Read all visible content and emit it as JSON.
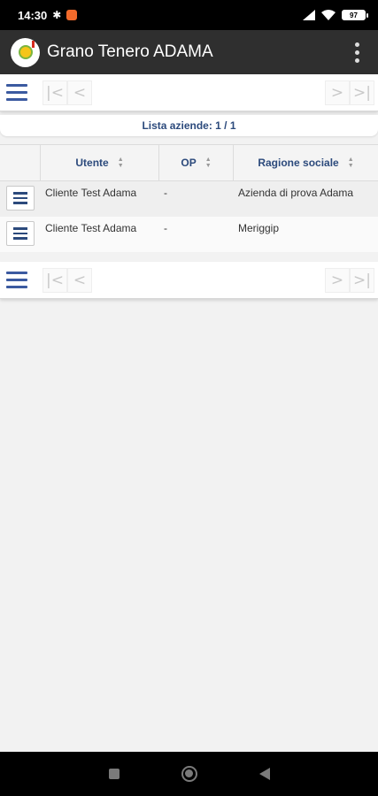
{
  "status_bar": {
    "time": "14:30",
    "battery": "97"
  },
  "app_bar": {
    "title": "Grano Tenero ADAMA"
  },
  "pager": {
    "first": "|<",
    "prev": "<",
    "next": ">",
    "last": ">|"
  },
  "list_label": "Lista aziende: 1 / 1",
  "table": {
    "headers": [
      "Utente",
      "OP",
      "Ragione sociale"
    ],
    "rows": [
      {
        "utente": "Cliente Test Adama",
        "op": "-",
        "ragione_sociale": "Azienda di prova Adama"
      },
      {
        "utente": "Cliente Test Adama",
        "op": "-",
        "ragione_sociale": "Meriggip"
      }
    ]
  },
  "colors": {
    "accent": "#2c4a7c",
    "app_bar": "#2f2f2f",
    "status_bar": "#000000"
  }
}
